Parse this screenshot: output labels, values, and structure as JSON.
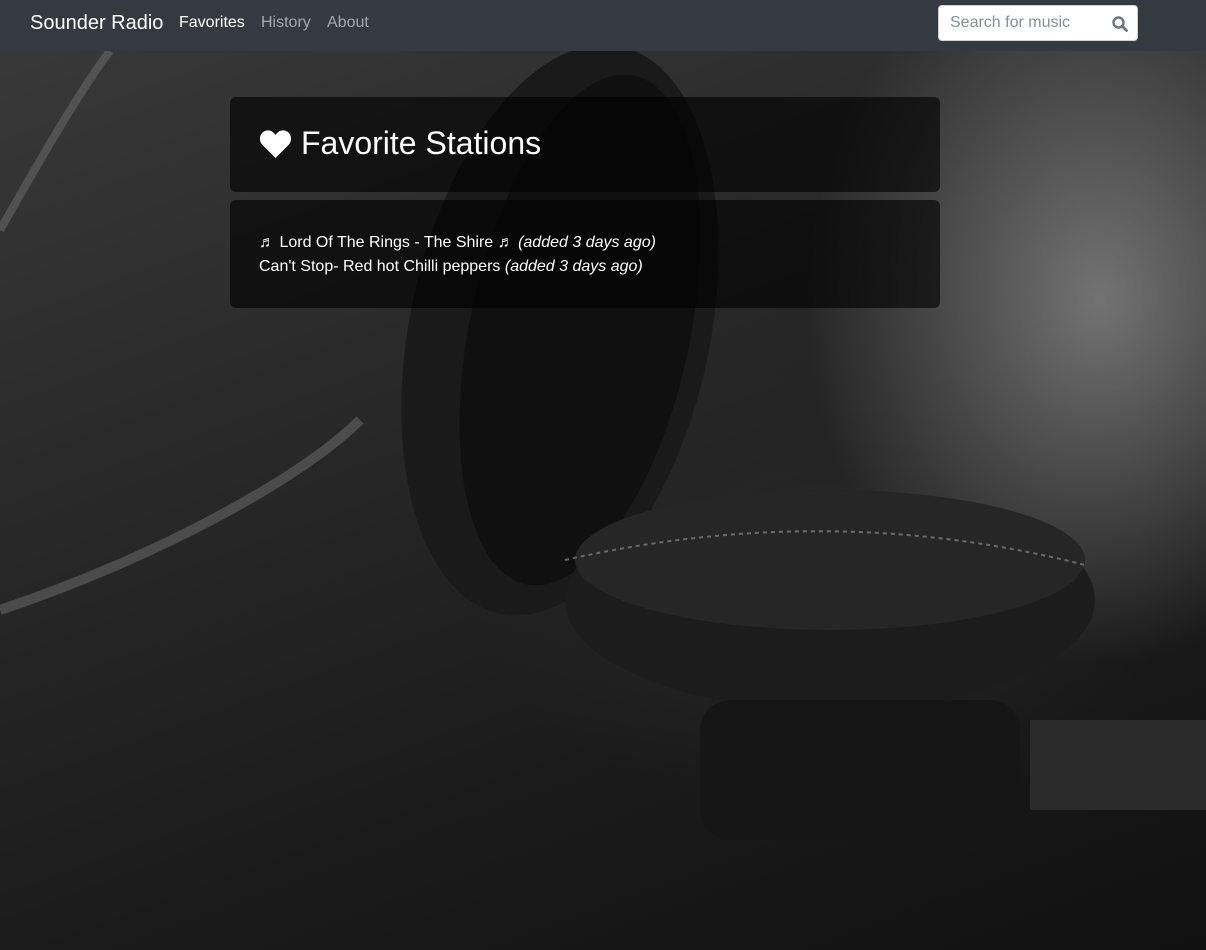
{
  "nav": {
    "brand": "Sounder Radio",
    "links": [
      {
        "label": "Favorites",
        "active": true
      },
      {
        "label": "History",
        "active": false
      },
      {
        "label": "About",
        "active": false
      }
    ],
    "search_placeholder": "Search for music",
    "search_icon": "search-icon"
  },
  "main": {
    "title": "Favorite Stations",
    "title_icon": "heart-icon",
    "stations": [
      {
        "name": "♬ Lord Of The Rings - The Shire ♬",
        "added": "(added 3 days ago)"
      },
      {
        "name": "Can't Stop- Red hot Chilli peppers",
        "added": "(added 3 days ago)"
      }
    ]
  },
  "colors": {
    "navbar": "#343a40",
    "card": "rgba(0,0,0,0.62)"
  }
}
